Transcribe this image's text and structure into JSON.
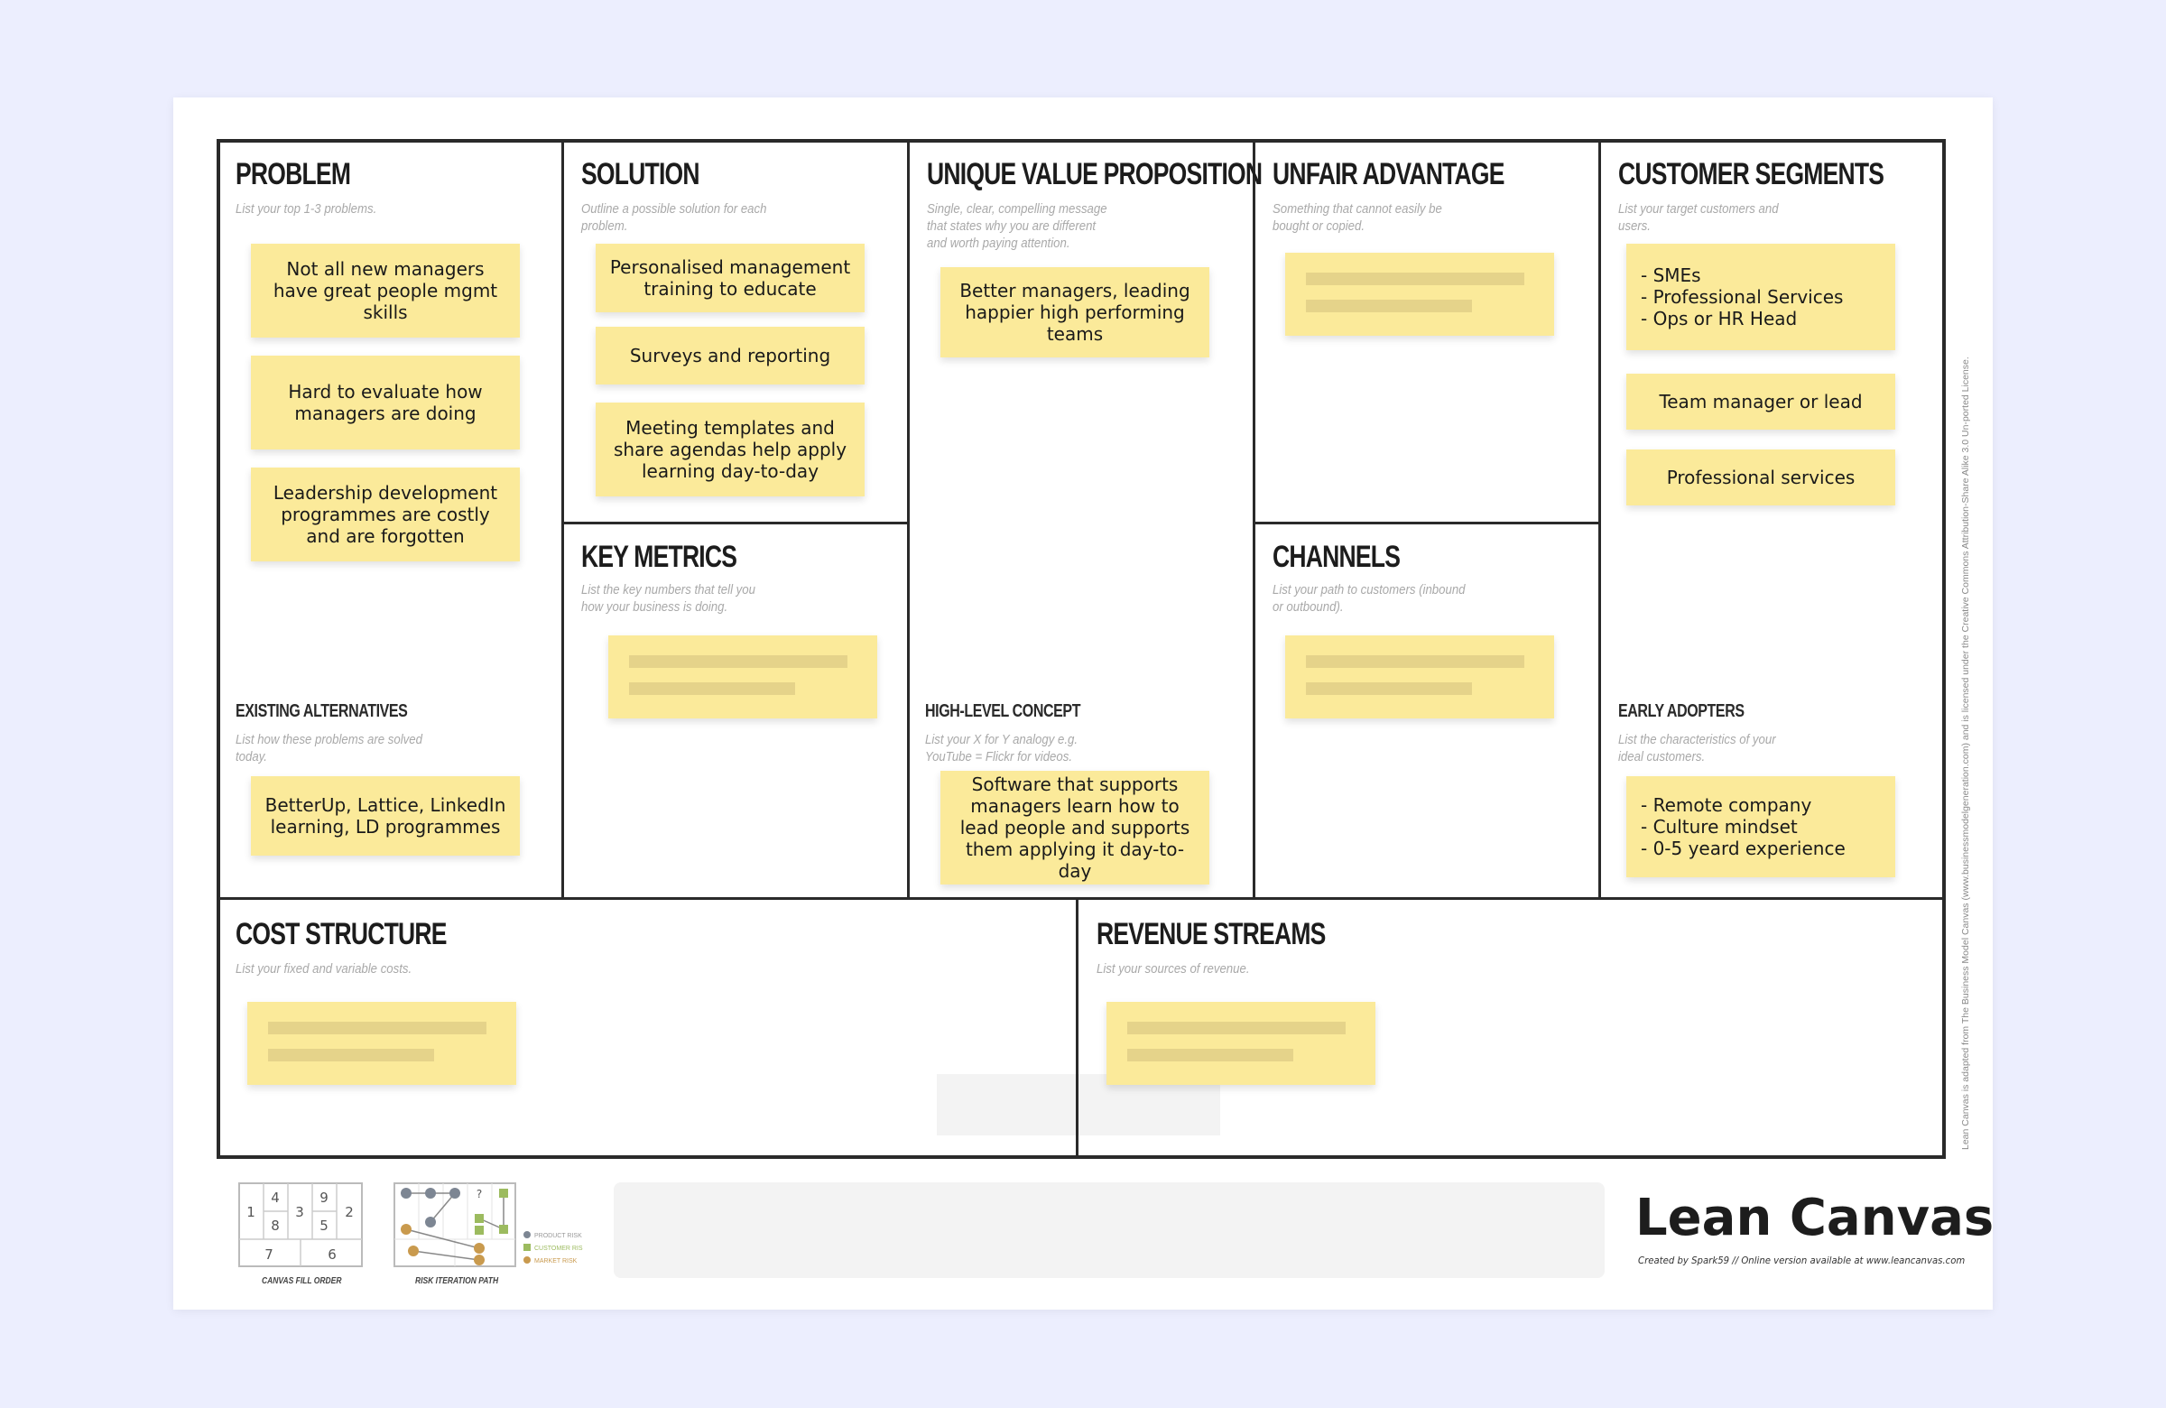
{
  "canvas": {
    "sections": {
      "problem": {
        "title": "PROBLEM",
        "hint": "List your top 1-3 problems.",
        "notes": [
          "Not all new managers have great people mgmt skills",
          "Hard to evaluate how managers are doing",
          "Leadership development programmes are costly and are forgotten"
        ]
      },
      "existing_alternatives": {
        "title": "EXISTING ALTERNATIVES",
        "hint": "List how these problems are solved today.",
        "notes": [
          "BetterUp, Lattice, LinkedIn learning, LD programmes"
        ]
      },
      "solution": {
        "title": "SOLUTION",
        "hint": "Outline a possible solution for each problem.",
        "notes": [
          "Personalised management training to educate",
          "Surveys and reporting",
          "Meeting templates and share agendas help apply learning day-to-day"
        ]
      },
      "key_metrics": {
        "title": "KEY METRICS",
        "hint": "List the key numbers that tell you how your business is doing.",
        "notes": []
      },
      "unique_value_proposition": {
        "title": "UNIQUE VALUE PROPOSITION",
        "hint": "Single, clear, compelling message that states why you are different and worth paying attention.",
        "notes": [
          "Better managers, leading happier high performing teams"
        ]
      },
      "high_level_concept": {
        "title": "HIGH-LEVEL CONCEPT",
        "hint": "List your X for Y analogy e.g. YouTube = Flickr for videos.",
        "notes": [
          "Software that supports managers learn how to lead people and supports them applying it day-to-day"
        ]
      },
      "unfair_advantage": {
        "title": "UNFAIR ADVANTAGE",
        "hint": "Something that cannot easily be bought or copied.",
        "notes": []
      },
      "channels": {
        "title": "CHANNELS",
        "hint": "List your path to customers (inbound or outbound).",
        "notes": []
      },
      "customer_segments": {
        "title": "CUSTOMER SEGMENTS",
        "hint": "List your target customers and users.",
        "notes": [
          "- SMEs\n- Professional Services\n- Ops or HR Head",
          "Team manager or lead",
          "Professional services"
        ]
      },
      "early_adopters": {
        "title": "EARLY ADOPTERS",
        "hint": "List the characteristics of your ideal customers.",
        "notes": [
          "- Remote company\n- Culture mindset\n- 0-5 yeard experience"
        ]
      },
      "cost_structure": {
        "title": "COST STRUCTURE",
        "hint": "List your fixed and variable costs.",
        "notes": []
      },
      "revenue_streams": {
        "title": "REVENUE STREAMS",
        "hint": "List your sources of revenue.",
        "notes": []
      }
    },
    "license_text": "Lean Canvas is adapted from The Business Model Canvas (www.businessmodelgeneration.com) and is licensed under the Creative Commons Attribution-Share Alike 3.0 Un-ported License."
  },
  "footer": {
    "fill_order": {
      "label": "CANVAS FILL ORDER",
      "cells": [
        "1",
        "4",
        "8",
        "3",
        "9",
        "5",
        "2",
        "7",
        "6"
      ]
    },
    "risk_path": {
      "label": "RISK ITERATION PATH",
      "legend": [
        "PRODUCT RISK",
        "CUSTOMER RISK",
        "MARKET RISK"
      ],
      "question_mark": "?"
    },
    "brand": {
      "title": "Lean Canvas",
      "subtitle": "Created by Spark59 // Online version available at www.leancanvas.com"
    }
  },
  "colors": {
    "background": "#eceefe",
    "sticky_note": "#fbea9a",
    "placeholder_bar": "#e5d38a",
    "grid_line": "#2a2a2a",
    "product_risk": "#7d8693",
    "customer_risk": "#9cbb5f",
    "market_risk": "#c99a4e"
  }
}
